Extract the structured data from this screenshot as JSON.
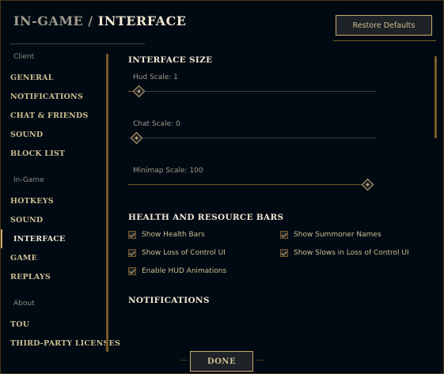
{
  "header": {
    "title_prefix": "IN-GAME",
    "separator": " / ",
    "title_current": "INTERFACE",
    "restore_label": "Restore Defaults"
  },
  "sidebar": {
    "groups": [
      {
        "label": "Client",
        "items": [
          "GENERAL",
          "NOTIFICATIONS",
          "CHAT & FRIENDS",
          "SOUND",
          "BLOCK LIST"
        ]
      },
      {
        "label": "In-Game",
        "items": [
          "HOTKEYS",
          "SOUND",
          "INTERFACE",
          "GAME",
          "REPLAYS"
        ]
      },
      {
        "label": "About",
        "items": [
          "TOU",
          "THIRD-PARTY LICENSES"
        ]
      }
    ],
    "active_item": "INTERFACE"
  },
  "main": {
    "interface_size": {
      "title": "INTERFACE SIZE",
      "sliders": [
        {
          "label": "Hud Scale: 1",
          "value": 1,
          "max": 100
        },
        {
          "label": "Chat Scale: 0",
          "value": 0,
          "max": 100
        },
        {
          "label": "Minimap Scale: 100",
          "value": 100,
          "max": 100
        }
      ]
    },
    "health_bars": {
      "title": "HEALTH AND RESOURCE BARS",
      "options": [
        {
          "label": "Show Health Bars",
          "checked": true
        },
        {
          "label": "Show Summoner Names",
          "checked": true
        },
        {
          "label": "Show Loss of Control UI",
          "checked": true
        },
        {
          "label": "Show Slows in Loss of Control UI",
          "checked": true
        },
        {
          "label": "Enable HUD Animations",
          "checked": true
        }
      ]
    },
    "notifications": {
      "title": "NOTIFICATIONS"
    }
  },
  "footer": {
    "done_label": "DONE"
  },
  "colors": {
    "background": "#010a13",
    "gold": "#c8aa6e",
    "gold_dark": "#785a28",
    "text_light": "#f0e6d2",
    "text_gold": "#cdbe91"
  }
}
